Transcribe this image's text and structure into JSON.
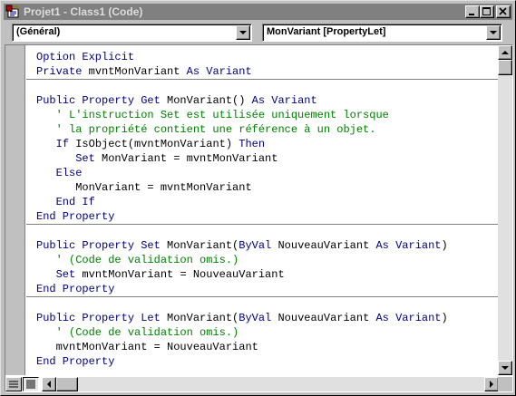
{
  "window": {
    "title": "Projet1 - Class1 (Code)",
    "icon": "vb-code-module-icon",
    "buttons": [
      "minimize-icon",
      "maximize-icon",
      "close-icon"
    ]
  },
  "toolbar": {
    "object_combo": "(Général)",
    "procedure_combo": "MonVariant [PropertyLet]"
  },
  "colors": {
    "keyword": "#00007f",
    "comment": "#007f00",
    "text": "#000000",
    "titlebar_inactive": "#808080"
  },
  "code": {
    "line_0": [
      {
        "t": "kw",
        "v": "Option Explicit"
      }
    ],
    "line_1": [
      {
        "t": "kw",
        "v": "Private"
      },
      {
        "t": "tx",
        "v": " mvntMonVariant "
      },
      {
        "t": "kw",
        "v": "As Variant"
      }
    ],
    "line_2": [
      {
        "t": "kw",
        "v": "Public Property Get"
      },
      {
        "t": "tx",
        "v": " MonVariant() "
      },
      {
        "t": "kw",
        "v": "As Variant"
      }
    ],
    "line_3": [
      {
        "t": "cm",
        "v": "   ' L'instruction Set est utilisée uniquement lorsque"
      }
    ],
    "line_4": [
      {
        "t": "cm",
        "v": "   ' la propriété contient une référence à un objet."
      }
    ],
    "line_5": [
      {
        "t": "tx",
        "v": "   "
      },
      {
        "t": "kw",
        "v": "If"
      },
      {
        "t": "tx",
        "v": " IsObject(mvntMonVariant) "
      },
      {
        "t": "kw",
        "v": "Then"
      }
    ],
    "line_6": [
      {
        "t": "tx",
        "v": "      "
      },
      {
        "t": "kw",
        "v": "Set"
      },
      {
        "t": "tx",
        "v": " MonVariant = mvntMonVariant"
      }
    ],
    "line_7": [
      {
        "t": "tx",
        "v": "   "
      },
      {
        "t": "kw",
        "v": "Else"
      }
    ],
    "line_8": [
      {
        "t": "tx",
        "v": "      MonVariant = mvntMonVariant"
      }
    ],
    "line_9": [
      {
        "t": "tx",
        "v": "   "
      },
      {
        "t": "kw",
        "v": "End If"
      }
    ],
    "line_10": [
      {
        "t": "kw",
        "v": "End Property"
      }
    ],
    "line_11": [
      {
        "t": "kw",
        "v": "Public Property Set"
      },
      {
        "t": "tx",
        "v": " MonVariant("
      },
      {
        "t": "kw",
        "v": "ByVal"
      },
      {
        "t": "tx",
        "v": " NouveauVariant "
      },
      {
        "t": "kw",
        "v": "As Variant"
      },
      {
        "t": "tx",
        "v": ")"
      }
    ],
    "line_12": [
      {
        "t": "cm",
        "v": "   ' (Code de validation omis.)"
      }
    ],
    "line_13": [
      {
        "t": "tx",
        "v": "   "
      },
      {
        "t": "kw",
        "v": "Set"
      },
      {
        "t": "tx",
        "v": " mvntMonVariant = NouveauVariant"
      }
    ],
    "line_14": [
      {
        "t": "kw",
        "v": "End Property"
      }
    ],
    "line_15": [
      {
        "t": "kw",
        "v": "Public Property Let"
      },
      {
        "t": "tx",
        "v": " MonVariant("
      },
      {
        "t": "kw",
        "v": "ByVal"
      },
      {
        "t": "tx",
        "v": " NouveauVariant "
      },
      {
        "t": "kw",
        "v": "As Variant"
      },
      {
        "t": "tx",
        "v": ")"
      }
    ],
    "line_16": [
      {
        "t": "cm",
        "v": "   ' (Code de validation omis.)"
      }
    ],
    "line_17": [
      {
        "t": "tx",
        "v": "   mvntMonVariant = NouveauVariant"
      }
    ],
    "line_18": [
      {
        "t": "kw",
        "v": "End Property"
      }
    ]
  },
  "scroll": {
    "vertical_position": 0.0,
    "horizontal_position": 0.0
  },
  "view_buttons": [
    "procedure-view-icon",
    "full-module-view-icon"
  ]
}
